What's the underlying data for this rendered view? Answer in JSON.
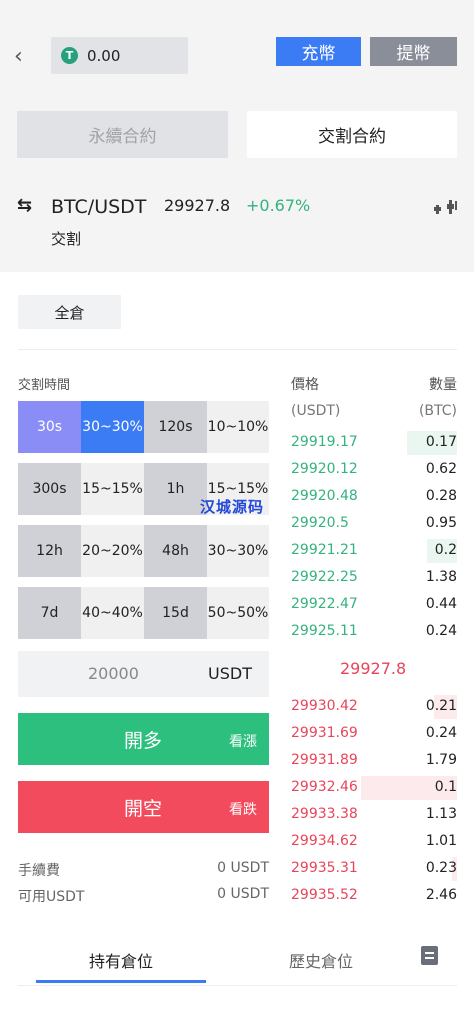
{
  "header": {
    "balance": "0.00",
    "usdt_icon_glyph": "T",
    "deposit_label": "充幣",
    "withdraw_label": "提幣"
  },
  "contract_tabs": {
    "perpetual": "永續合約",
    "delivery": "交割合約"
  },
  "ticker": {
    "pair": "BTC/USDT",
    "price": "29927.8",
    "change": "+0.67%",
    "subtype": "交割"
  },
  "margin_mode": "全倉",
  "trade": {
    "time_label": "交割時間",
    "options": [
      {
        "time": "30s",
        "payout": "30~30%",
        "selected": true
      },
      {
        "time": "120s",
        "payout": "10~10%",
        "selected": false
      },
      {
        "time": "300s",
        "payout": "15~15%",
        "selected": false
      },
      {
        "time": "1h",
        "payout": "15~15%",
        "selected": false
      },
      {
        "time": "12h",
        "payout": "20~20%",
        "selected": false
      },
      {
        "time": "48h",
        "payout": "30~30%",
        "selected": false
      },
      {
        "time": "7d",
        "payout": "40~40%",
        "selected": false
      },
      {
        "time": "15d",
        "payout": "50~50%",
        "selected": false
      }
    ],
    "amount": "20000",
    "amount_unit": "USDT",
    "long_label": "開多",
    "long_sub": "看漲",
    "short_label": "開空",
    "short_sub": "看跌",
    "fee_label": "手續費",
    "fee_value": "0 USDT",
    "available_label": "可用USDT",
    "available_value": "0 USDT"
  },
  "orderbook": {
    "price_header": "價格",
    "qty_header": "數量",
    "price_unit": "(USDT)",
    "qty_unit": "(BTC)",
    "bids": [
      {
        "price": "29919.17",
        "qty": "0.17",
        "depth": 0.3
      },
      {
        "price": "29920.12",
        "qty": "0.62",
        "depth": 0
      },
      {
        "price": "29920.48",
        "qty": "0.28",
        "depth": 0
      },
      {
        "price": "29920.5",
        "qty": "0.95",
        "depth": 0
      },
      {
        "price": "29921.21",
        "qty": "0.2",
        "depth": 0.18
      },
      {
        "price": "29922.25",
        "qty": "1.38",
        "depth": 0
      },
      {
        "price": "29922.47",
        "qty": "0.44",
        "depth": 0
      },
      {
        "price": "29925.11",
        "qty": "0.24",
        "depth": 0
      }
    ],
    "mid_price": "29927.8",
    "asks": [
      {
        "price": "29930.42",
        "qty": "0.21",
        "depth": 0.14
      },
      {
        "price": "29931.69",
        "qty": "0.24",
        "depth": 0
      },
      {
        "price": "29931.89",
        "qty": "1.79",
        "depth": 0
      },
      {
        "price": "29932.46",
        "qty": "0.1",
        "depth": 0.58
      },
      {
        "price": "29933.38",
        "qty": "1.13",
        "depth": 0
      },
      {
        "price": "29934.62",
        "qty": "1.01",
        "depth": 0
      },
      {
        "price": "29935.31",
        "qty": "0.23",
        "depth": 0.03
      },
      {
        "price": "29935.52",
        "qty": "2.46",
        "depth": 0
      }
    ]
  },
  "watermark": "汉城源码",
  "bottom_tabs": {
    "holdings": "持有倉位",
    "history": "歷史倉位"
  },
  "colors": {
    "accent": "#3b7cf5",
    "up": "#34b37e",
    "down": "#e8455a",
    "selected_time": "#8b8df7"
  }
}
